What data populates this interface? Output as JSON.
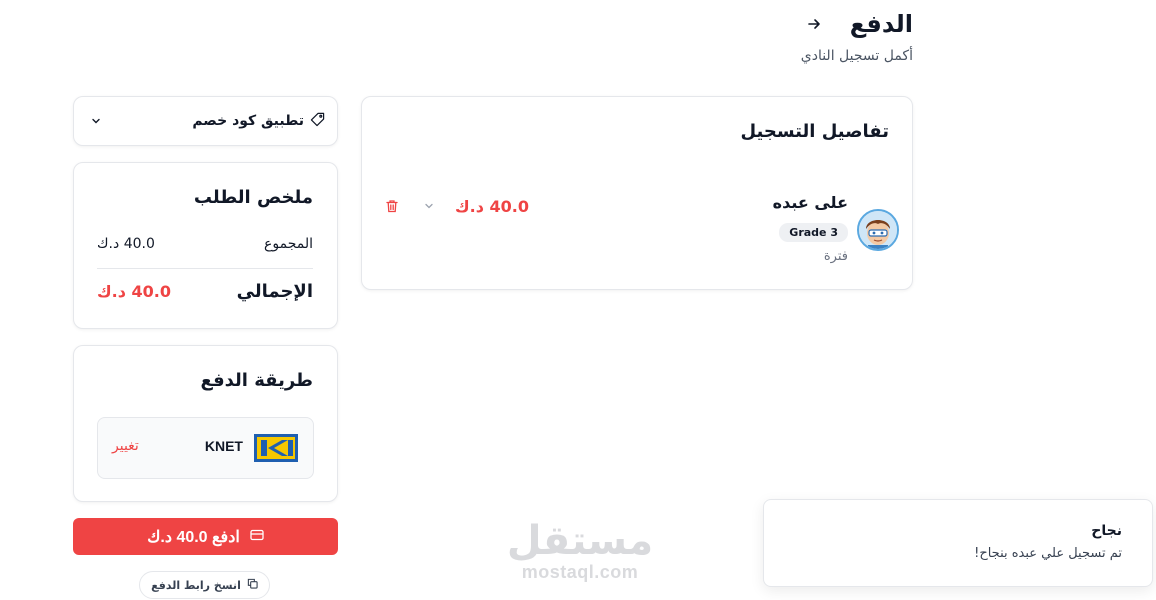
{
  "header": {
    "title": "الدفع",
    "subtitle": "أكمل تسجيل النادي",
    "back_icon": "arrow-right-icon"
  },
  "registration": {
    "title": "تفاصيل التسجيل",
    "student_name": "على عبده",
    "grade": "Grade 3",
    "period": "فترة",
    "price": "40.0 د.ك",
    "price_color": "#ef4444",
    "icons": {
      "avatar": "student-avatar",
      "expand": "chevron-down-icon",
      "delete": "trash-icon"
    }
  },
  "coupon": {
    "label": "تطبيق كود خصم",
    "icons": {
      "tag": "tag-icon",
      "expand": "chevron-down-icon"
    }
  },
  "summary": {
    "title": "ملخص الطلب",
    "subtotal_label": "المجموع",
    "subtotal_value": "40.0 د.ك",
    "total_label": "الإجمالي",
    "total_value": "40.0 د.ك"
  },
  "payment": {
    "title": "طريقة الدفع",
    "method_name": "KNET",
    "change_label": "تغيير",
    "logo_colors": {
      "blue": "#1f5fb0",
      "yellow": "#f6c700"
    }
  },
  "pay_button": {
    "label": "ادفع 40.0 د.ك",
    "icon": "credit-card-icon",
    "color": "#ef4444"
  },
  "copy_link": {
    "label": "انسخ رابط الدفع",
    "icon": "copy-icon"
  },
  "watermark": {
    "arabic": "مستقل",
    "latin": "mostaql.com"
  },
  "toast": {
    "title": "نجاح",
    "message": "تم تسجيل علي عبده بنجاح!"
  }
}
